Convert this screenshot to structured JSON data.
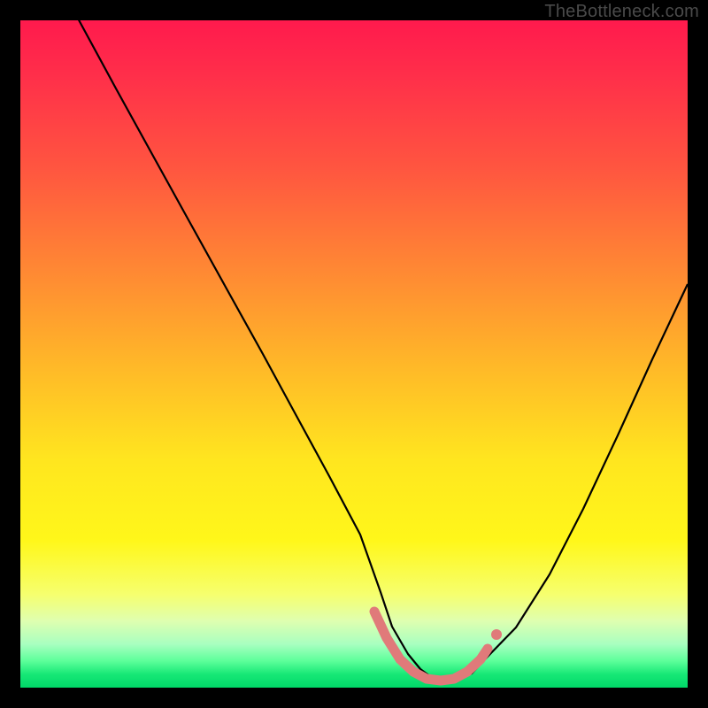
{
  "watermark": "TheBottleneck.com",
  "chart_data": {
    "type": "line",
    "title": "",
    "xlabel": "",
    "ylabel": "",
    "xlim": [
      0,
      100
    ],
    "ylim": [
      0,
      100
    ],
    "grid": false,
    "series": [
      {
        "name": "curve",
        "color": "#000000",
        "x": [
          10,
          15,
          20,
          25,
          30,
          35,
          40,
          45,
          50,
          53,
          55,
          58,
          60,
          62,
          65,
          68,
          70,
          75,
          80,
          85,
          90,
          95,
          100
        ],
        "y": [
          100,
          90,
          80,
          70,
          60,
          50,
          40,
          30,
          20,
          12,
          8,
          4,
          2,
          1,
          1,
          2,
          4,
          9,
          17,
          27,
          38,
          49,
          60
        ]
      }
    ],
    "highlight": {
      "name": "bottom-marker",
      "color": "#e07a7a",
      "x": [
        53,
        55,
        57,
        59,
        61,
        63,
        65,
        67,
        69,
        70
      ],
      "y": [
        11,
        7,
        4,
        2,
        1,
        1,
        1,
        2,
        4,
        6
      ]
    }
  }
}
